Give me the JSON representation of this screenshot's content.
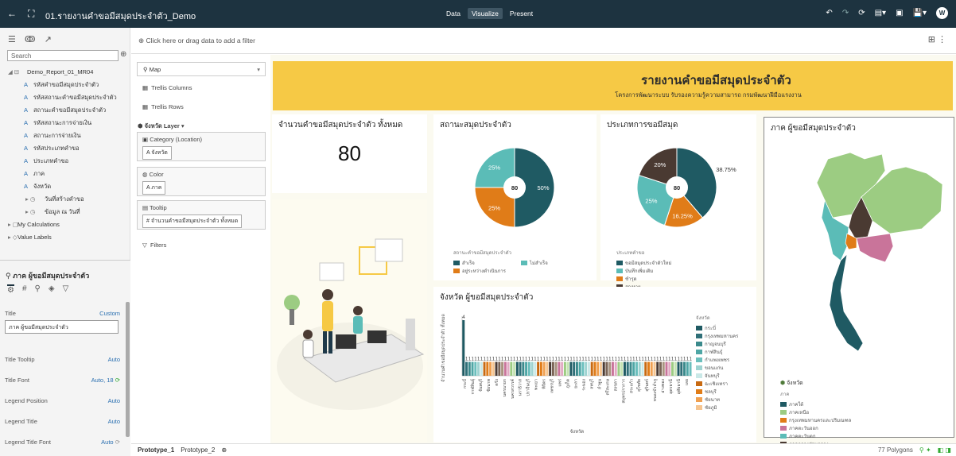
{
  "app": {
    "title": "01.รายงานคำขอมีสมุดประจำตัว_Demo",
    "modes": [
      "Data",
      "Visualize",
      "Present"
    ],
    "active_mode": "Visualize",
    "user_initial": "W"
  },
  "left_panel": {
    "search_placeholder": "Search",
    "tree": [
      {
        "label": "Demo_Report_01_MR04",
        "level": 1,
        "icon": "database-icon"
      },
      {
        "label": "รหัสคำขอมีสมุดประจำตัว",
        "level": 2,
        "icon": "attribute-icon"
      },
      {
        "label": "รหัสสถานะคำขอมีสมุดประจำตัว",
        "level": 2,
        "icon": "attribute-icon"
      },
      {
        "label": "สถานะคำขอมีสมุดประจำตัว",
        "level": 2,
        "icon": "attribute-icon"
      },
      {
        "label": "รหัสสถานะการจ่ายเงิน",
        "level": 2,
        "icon": "attribute-icon"
      },
      {
        "label": "สถานะการจ่ายเงิน",
        "level": 2,
        "icon": "attribute-icon"
      },
      {
        "label": "รหัสประเภทคำขอ",
        "level": 2,
        "icon": "attribute-icon"
      },
      {
        "label": "ประเภทคำขอ",
        "level": 2,
        "icon": "attribute-icon"
      },
      {
        "label": "ภาค",
        "level": 2,
        "icon": "attribute-icon"
      },
      {
        "label": "จังหวัด",
        "level": 2,
        "icon": "attribute-icon"
      },
      {
        "label": "วันที่สร้างคำขอ",
        "level": 3,
        "icon": "clock-icon"
      },
      {
        "label": "ข้อมูล ณ วันที่",
        "level": 3,
        "icon": "clock-icon"
      },
      {
        "label": "My Calculations",
        "level": 1,
        "icon": "folder-icon"
      },
      {
        "label": "Value Labels",
        "level": 1,
        "icon": "tag-icon"
      }
    ],
    "properties": {
      "title": "ภาค ผู้ขอมีสมุดประจำตัว",
      "rows": [
        {
          "label": "Title",
          "value": "Custom"
        },
        {
          "label": "Title Tooltip",
          "value": "Auto"
        },
        {
          "label": "Title Font",
          "value": "Auto, 18"
        },
        {
          "label": "Legend Position",
          "value": "Auto"
        },
        {
          "label": "Legend Title",
          "value": "Auto"
        },
        {
          "label": "Legend Title Font",
          "value": "Auto"
        }
      ],
      "title_input": "ภาค ผู้ขอมีสมุดประจำตัว"
    }
  },
  "filter_bar": {
    "text": "Click here or drag data to add a filter"
  },
  "grammar": {
    "viz_type": "Map",
    "trellis_columns": "Trellis Columns",
    "trellis_rows": "Trellis Rows",
    "layer": "จังหวัด Layer",
    "boxes": [
      {
        "header": "Category (Location)",
        "pill": "A จังหวัด"
      },
      {
        "header": "Color",
        "pill": "A ภาค"
      },
      {
        "header": "Tooltip",
        "pill": "# จำนวนคำขอมีสมุดประจำตัว ทั้งหมด"
      }
    ],
    "filters": "Filters"
  },
  "banner": {
    "title": "รายงานคำขอมีสมุดประจำตัว",
    "subtitle": "โครงการพัฒนาระบบ รับรองความรู้ความสามารถ กรมพัฒนาฝีมือแรงงาน"
  },
  "kpi": {
    "title": "จำนวนคำขอมีสมุดประจำตัว ทั้งหมด",
    "value": "80"
  },
  "status_chart": {
    "title": "สถานะสมุดประจำตัว",
    "center": "80",
    "legend_title": "สถานะคำขอมีสมุดประจำตัว",
    "slices": [
      {
        "name": "สำเร็จ",
        "value": 50,
        "label": "50%",
        "color": "#1f5a63"
      },
      {
        "name": "อยู่ระหว่างดำเนินการ",
        "value": 25,
        "label": "25%",
        "color": "#e07c18"
      },
      {
        "name": "ไม่สำเร็จ",
        "value": 25,
        "label": "25%",
        "color": "#5bbcb7"
      }
    ]
  },
  "type_chart": {
    "title": "ประเภทการขอมีสมุด",
    "center": "80",
    "legend_title": "ประเภทคำขอ",
    "slices": [
      {
        "name": "ขอมีสมุดประจำตัวใหม่",
        "value": 38.75,
        "label": "38.75%",
        "color": "#1f5a63"
      },
      {
        "name": "ชำรุด",
        "value": 16.25,
        "label": "16.25%",
        "color": "#e07c18"
      },
      {
        "name": "บันทึกเพิ่มเติม",
        "value": 25,
        "label": "25%",
        "color": "#5bbcb7"
      },
      {
        "name": "สูญหาย",
        "value": 20,
        "label": "20%",
        "color": "#4a3a32"
      }
    ]
  },
  "bar_card": {
    "title": "จังหวัด ผู้ขอมีสมุดประจำตัว",
    "ylabel": "จำนวนคำขอมีสมุดประจำตัว ทั้งหมด",
    "xlabel": "จังหวัด",
    "legend_title": "จังหวัด",
    "legend_items": [
      {
        "name": "กระบี่",
        "color": "#1f5a63"
      },
      {
        "name": "กรุงเทพมหานคร",
        "color": "#2f6f78"
      },
      {
        "name": "กาญจนบุรี",
        "color": "#3b8a8c"
      },
      {
        "name": "กาฬสินธุ์",
        "color": "#4ea6a5"
      },
      {
        "name": "กำแพงเพชร",
        "color": "#6bbfbd"
      },
      {
        "name": "ขอนแก่น",
        "color": "#9ed3d1"
      },
      {
        "name": "จันทบุรี",
        "color": "#c9e8e7"
      },
      {
        "name": "ฉะเชิงเทรา",
        "color": "#c86a12"
      },
      {
        "name": "ชลบุรี",
        "color": "#e07c18"
      },
      {
        "name": "ชัยนาท",
        "color": "#f0a050"
      },
      {
        "name": "ชัยภูมิ",
        "color": "#f6c590"
      }
    ]
  },
  "map_card": {
    "title": "ภาค ผู้ขอมีสมุดประจำตัว",
    "legend_layer": "จังหวัด",
    "legend_title": "ภาค",
    "legend_items": [
      {
        "name": "ภาคใต้",
        "color": "#1f5a63"
      },
      {
        "name": "ภาคเหนือ",
        "color": "#9ccc82"
      },
      {
        "name": "กรุงเทพมหานครและปริมณฑล",
        "color": "#e07c18"
      },
      {
        "name": "ภาคตะวันออก",
        "color": "#c9749a"
      },
      {
        "name": "ภาคตะวันตก",
        "color": "#5bbcb7"
      },
      {
        "name": "ภาคกลางส่วนกลาง",
        "color": "#4a3a32"
      }
    ]
  },
  "chart_data": [
    {
      "type": "pie",
      "title": "สถานะสมุดประจำตัว",
      "categories": [
        "สำเร็จ",
        "อยู่ระหว่างดำเนินการ",
        "ไม่สำเร็จ"
      ],
      "values": [
        50,
        25,
        25
      ]
    },
    {
      "type": "pie",
      "title": "ประเภทการขอมีสมุด",
      "categories": [
        "ขอมีสมุดประจำตัวใหม่",
        "ชำรุด",
        "บันทึกเพิ่มเติม",
        "สูญหาย"
      ],
      "values": [
        38.75,
        16.25,
        25,
        20
      ]
    },
    {
      "type": "bar",
      "title": "จังหวัด ผู้ขอมีสมุดประจำตัว",
      "xlabel": "จังหวัด",
      "ylabel": "จำนวนคำขอมีสมุดประจำตัว ทั้งหมด",
      "ylim": [
        0,
        4
      ],
      "values": [
        4,
        1,
        1,
        1,
        1,
        1,
        1,
        1,
        1,
        1,
        1,
        1,
        1,
        1,
        1,
        1,
        1,
        1,
        1,
        1,
        1,
        1,
        1,
        1,
        1,
        1,
        1,
        1,
        1,
        1,
        1,
        1,
        1,
        1,
        1,
        1,
        1,
        1,
        1,
        1,
        1,
        1,
        1,
        1,
        1,
        1,
        1,
        1,
        1,
        1,
        1,
        1,
        1,
        1,
        1,
        1,
        1,
        1,
        1,
        1,
        1,
        1,
        1,
        1,
        1,
        1,
        1,
        1,
        1,
        1,
        1,
        1,
        1,
        1,
        1,
        1,
        1
      ],
      "categories_shown": [
        "กระบี่",
        "กาฬสินธุ์",
        "จันทบุรี",
        "ชัยนาท",
        "ตรัง",
        "นครนายก",
        "นครสวรรค์",
        "นราธิวาส",
        "ปราจีนบุรี",
        "พะเยา",
        "พิจิตร",
        "เพชรบุรี",
        "แพร่",
        "ภูเก็ต",
        "ยะลา",
        "ระนอง",
        "ลพบุรี",
        "ลำพูน",
        "ศรีสะเกษ",
        "สงขลา",
        "สมุทรปราการ",
        "สระแก้ว",
        "สุโขทัย",
        "สุรินทร์",
        "หนองบัวลำภู",
        "อ่างทอง",
        "อุดรธานี",
        "อุทัยธานี",
        "เลย"
      ]
    }
  ],
  "bottom_bar": {
    "tabs": [
      "Prototype_1",
      "Prototype_2"
    ],
    "active_tab": "Prototype_1",
    "status": "77 Polygons"
  }
}
